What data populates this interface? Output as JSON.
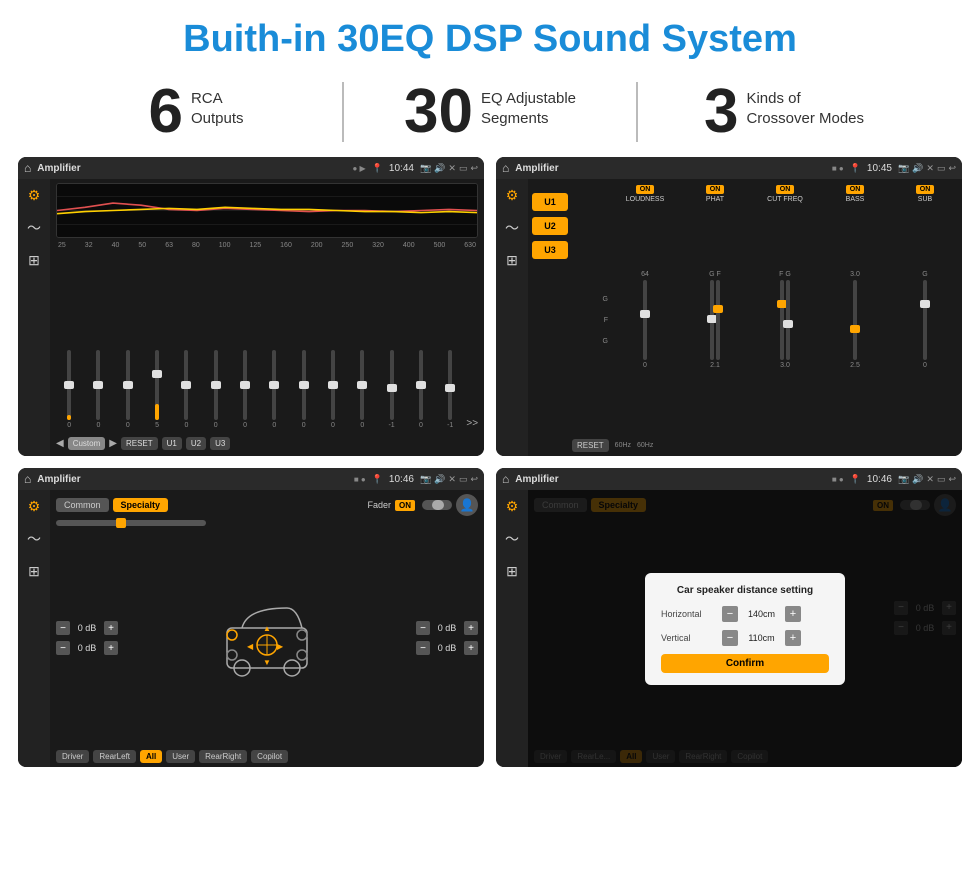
{
  "page": {
    "title": "Buith-in 30EQ DSP Sound System"
  },
  "stats": [
    {
      "number": "6",
      "text_line1": "RCA",
      "text_line2": "Outputs"
    },
    {
      "number": "30",
      "text_line1": "EQ Adjustable",
      "text_line2": "Segments"
    },
    {
      "number": "3",
      "text_line1": "Kinds of",
      "text_line2": "Crossover Modes"
    }
  ],
  "screens": {
    "top_left": {
      "app_name": "Amplifier",
      "time": "10:44",
      "eq_labels": [
        "25",
        "32",
        "40",
        "50",
        "63",
        "80",
        "100",
        "125",
        "160",
        "200",
        "250",
        "320",
        "400",
        "500",
        "630"
      ],
      "eq_values": [
        "0",
        "0",
        "0",
        "5",
        "0",
        "0",
        "0",
        "0",
        "0",
        "0",
        "0",
        "-1",
        "0",
        "-1"
      ],
      "nav_buttons": [
        "Custom",
        "RESET",
        "U1",
        "U2",
        "U3"
      ]
    },
    "top_right": {
      "app_name": "Amplifier",
      "time": "10:45",
      "presets": [
        "U1",
        "U2",
        "U3"
      ],
      "channels": [
        {
          "toggle": "ON",
          "name": "LOUDNESS"
        },
        {
          "toggle": "ON",
          "name": "PHAT"
        },
        {
          "toggle": "ON",
          "name": "CUT FREQ"
        },
        {
          "toggle": "ON",
          "name": "BASS"
        },
        {
          "toggle": "ON",
          "name": "SUB"
        }
      ],
      "reset_label": "RESET"
    },
    "bottom_left": {
      "app_name": "Amplifier",
      "time": "10:46",
      "tabs": [
        "Common",
        "Specialty"
      ],
      "fader_label": "Fader",
      "fader_on": "ON",
      "db_values": [
        "0 dB",
        "0 dB",
        "0 dB",
        "0 dB"
      ],
      "bottom_buttons": [
        "Driver",
        "RearLeft",
        "All",
        "User",
        "RearRight",
        "Copilot"
      ]
    },
    "bottom_right": {
      "app_name": "Amplifier",
      "time": "10:46",
      "tabs": [
        "Common",
        "Specialty"
      ],
      "dialog": {
        "title": "Car speaker distance setting",
        "horizontal_label": "Horizontal",
        "horizontal_value": "140cm",
        "vertical_label": "Vertical",
        "vertical_value": "110cm",
        "confirm_label": "Confirm"
      },
      "bottom_buttons": [
        "Driver",
        "RearLeft",
        "All",
        "User",
        "RearRight",
        "Copilot"
      ],
      "db_values": [
        "0 dB",
        "0 dB"
      ]
    }
  }
}
